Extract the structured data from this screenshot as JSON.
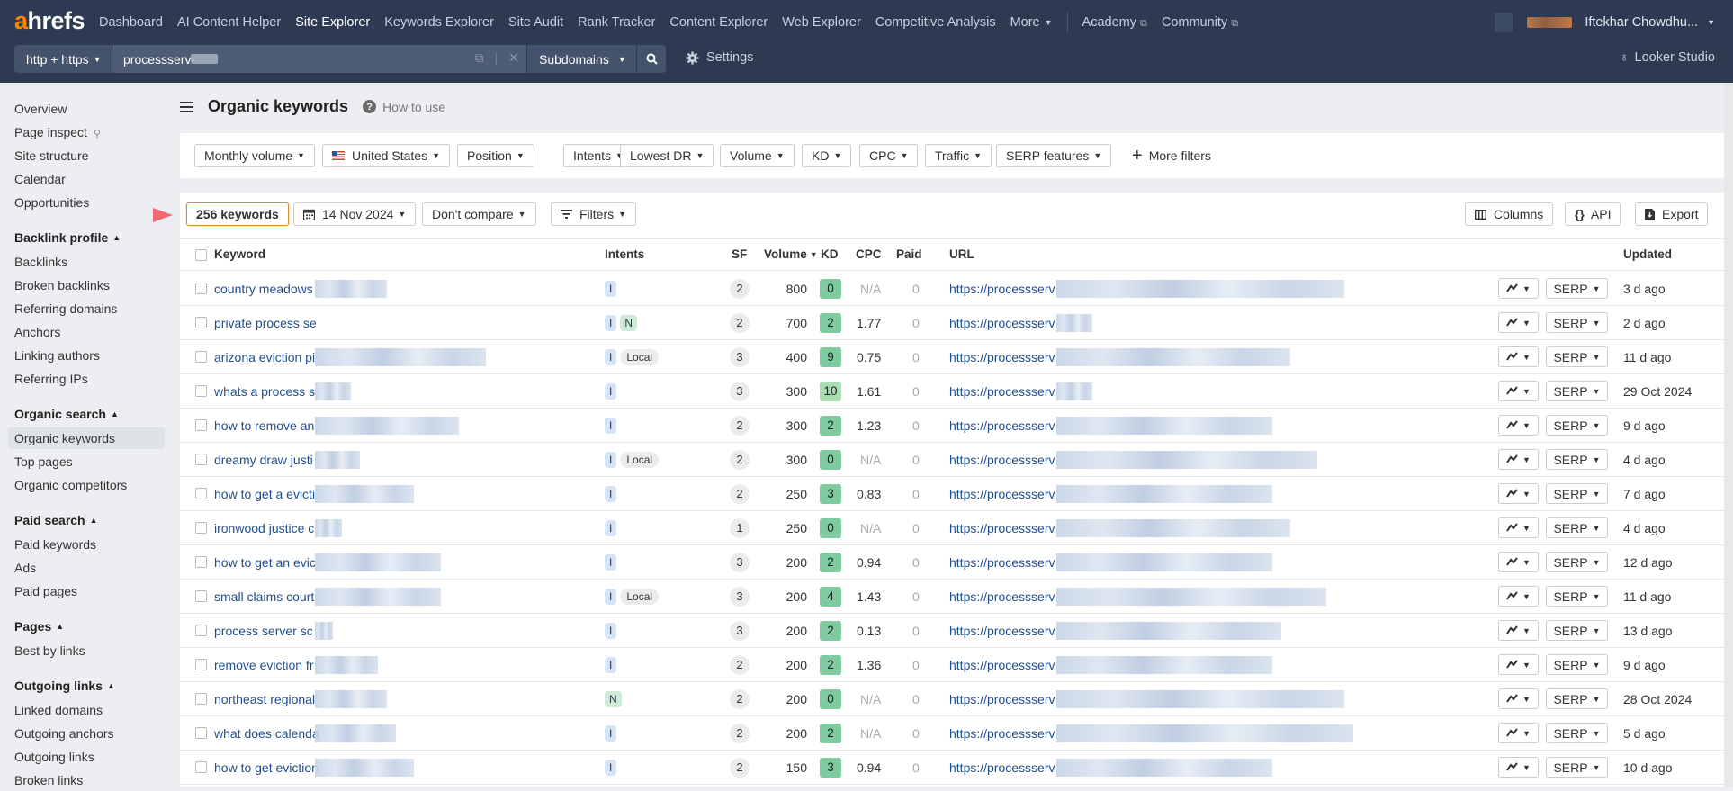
{
  "app": {
    "logo_prefix": "a",
    "logo_rest": "hrefs"
  },
  "nav": {
    "items": [
      {
        "label": "Dashboard",
        "active": false
      },
      {
        "label": "AI Content Helper",
        "active": false
      },
      {
        "label": "Site Explorer",
        "active": true
      },
      {
        "label": "Keywords Explorer",
        "active": false
      },
      {
        "label": "Site Audit",
        "active": false
      },
      {
        "label": "Rank Tracker",
        "active": false
      },
      {
        "label": "Content Explorer",
        "active": false
      },
      {
        "label": "Web Explorer",
        "active": false
      },
      {
        "label": "Competitive Analysis",
        "active": false
      }
    ],
    "more_label": "More",
    "external": [
      {
        "label": "Academy"
      },
      {
        "label": "Community"
      }
    ],
    "user_name": "Iftekhar Chowdhu..."
  },
  "search": {
    "protocol": "http + https",
    "target": "processserv",
    "mode": "Subdomains",
    "settings_label": "Settings",
    "looker_label": "Looker Studio"
  },
  "sidebar": {
    "top": [
      "Overview",
      "Page inspect",
      "Site structure",
      "Calendar",
      "Opportunities"
    ],
    "sections": [
      {
        "title": "Backlink profile",
        "items": [
          "Backlinks",
          "Broken backlinks",
          "Referring domains",
          "Anchors",
          "Linking authors",
          "Referring IPs"
        ]
      },
      {
        "title": "Organic search",
        "items": [
          "Organic keywords",
          "Top pages",
          "Organic competitors"
        ]
      },
      {
        "title": "Paid search",
        "items": [
          "Paid keywords",
          "Ads",
          "Paid pages"
        ]
      },
      {
        "title": "Pages",
        "items": [
          "Best by links"
        ]
      },
      {
        "title": "Outgoing links",
        "items": [
          "Linked domains",
          "Outgoing anchors",
          "Outgoing links",
          "Broken links"
        ]
      }
    ],
    "selected": "Organic keywords"
  },
  "page": {
    "title": "Organic keywords",
    "how_to_use": "How to use"
  },
  "filters": [
    {
      "label": "Monthly volume"
    },
    {
      "label": "United States",
      "flag": "us"
    },
    {
      "label": "Position"
    },
    {
      "label": "Intents"
    },
    {
      "label": "Lowest DR"
    },
    {
      "label": "Volume"
    },
    {
      "label": "KD"
    },
    {
      "label": "CPC"
    },
    {
      "label": "Traffic"
    },
    {
      "label": "SERP features"
    }
  ],
  "more_filters_label": "More filters",
  "toolbar": {
    "keyword_count": "256 keywords",
    "date": "14 Nov 2024",
    "compare": "Don't compare",
    "filters": "Filters",
    "columns": "Columns",
    "api": "API",
    "export": "Export"
  },
  "table": {
    "headers": {
      "keyword": "Keyword",
      "intents": "Intents",
      "sf": "SF",
      "volume": "Volume",
      "kd": "KD",
      "cpc": "CPC",
      "paid": "Paid",
      "url": "URL",
      "updated": "Updated"
    },
    "serp_label": "SERP",
    "url_prefix": "https://processserv",
    "kd_colors": {
      "low": "#7fcba0",
      "mid": "#a9dcb3"
    },
    "rows": [
      {
        "keyword": "country meadows",
        "intents": [
          "I"
        ],
        "sf": "2",
        "volume": "800",
        "kd": "0",
        "cpc": "N/A",
        "paid": "0",
        "updated": "3 d ago"
      },
      {
        "keyword": "private process se",
        "intents": [
          "I",
          "N"
        ],
        "sf": "2",
        "volume": "700",
        "kd": "2",
        "cpc": "1.77",
        "paid": "0",
        "updated": "2 d ago"
      },
      {
        "keyword": "arizona eviction pi",
        "intents": [
          "I",
          "Local"
        ],
        "sf": "3",
        "volume": "400",
        "kd": "9",
        "cpc": "0.75",
        "paid": "0",
        "updated": "11 d ago"
      },
      {
        "keyword": "whats a process s",
        "intents": [
          "I"
        ],
        "sf": "3",
        "volume": "300",
        "kd": "10",
        "cpc": "1.61",
        "paid": "0",
        "updated": "29 Oct 2024"
      },
      {
        "keyword": "how to remove an",
        "intents": [
          "I"
        ],
        "sf": "2",
        "volume": "300",
        "kd": "2",
        "cpc": "1.23",
        "paid": "0",
        "updated": "9 d ago"
      },
      {
        "keyword": "dreamy draw justi",
        "intents": [
          "I",
          "Local"
        ],
        "sf": "2",
        "volume": "300",
        "kd": "0",
        "cpc": "N/A",
        "paid": "0",
        "updated": "4 d ago"
      },
      {
        "keyword": "how to get a evicti",
        "intents": [
          "I"
        ],
        "sf": "2",
        "volume": "250",
        "kd": "3",
        "cpc": "0.83",
        "paid": "0",
        "updated": "7 d ago"
      },
      {
        "keyword": "ironwood justice c",
        "intents": [
          "I"
        ],
        "sf": "1",
        "volume": "250",
        "kd": "0",
        "cpc": "N/A",
        "paid": "0",
        "updated": "4 d ago"
      },
      {
        "keyword": "how to get an evic",
        "intents": [
          "I"
        ],
        "sf": "3",
        "volume": "200",
        "kd": "2",
        "cpc": "0.94",
        "paid": "0",
        "updated": "12 d ago"
      },
      {
        "keyword": "small claims court",
        "intents": [
          "I",
          "Local"
        ],
        "sf": "3",
        "volume": "200",
        "kd": "4",
        "cpc": "1.43",
        "paid": "0",
        "updated": "11 d ago"
      },
      {
        "keyword": "process server sc",
        "intents": [
          "I"
        ],
        "sf": "3",
        "volume": "200",
        "kd": "2",
        "cpc": "0.13",
        "paid": "0",
        "updated": "13 d ago"
      },
      {
        "keyword": "remove eviction fr",
        "intents": [
          "I"
        ],
        "sf": "2",
        "volume": "200",
        "kd": "2",
        "cpc": "1.36",
        "paid": "0",
        "updated": "9 d ago"
      },
      {
        "keyword": "northeast regional",
        "intents": [
          "N"
        ],
        "sf": "2",
        "volume": "200",
        "kd": "0",
        "cpc": "N/A",
        "paid": "0",
        "updated": "28 Oct 2024"
      },
      {
        "keyword": "what does calenda",
        "intents": [
          "I"
        ],
        "sf": "2",
        "volume": "200",
        "kd": "2",
        "cpc": "N/A",
        "paid": "0",
        "updated": "5 d ago"
      },
      {
        "keyword": "how to get eviction",
        "intents": [
          "I"
        ],
        "sf": "2",
        "volume": "150",
        "kd": "3",
        "cpc": "0.94",
        "paid": "0",
        "updated": "10 d ago"
      }
    ]
  }
}
